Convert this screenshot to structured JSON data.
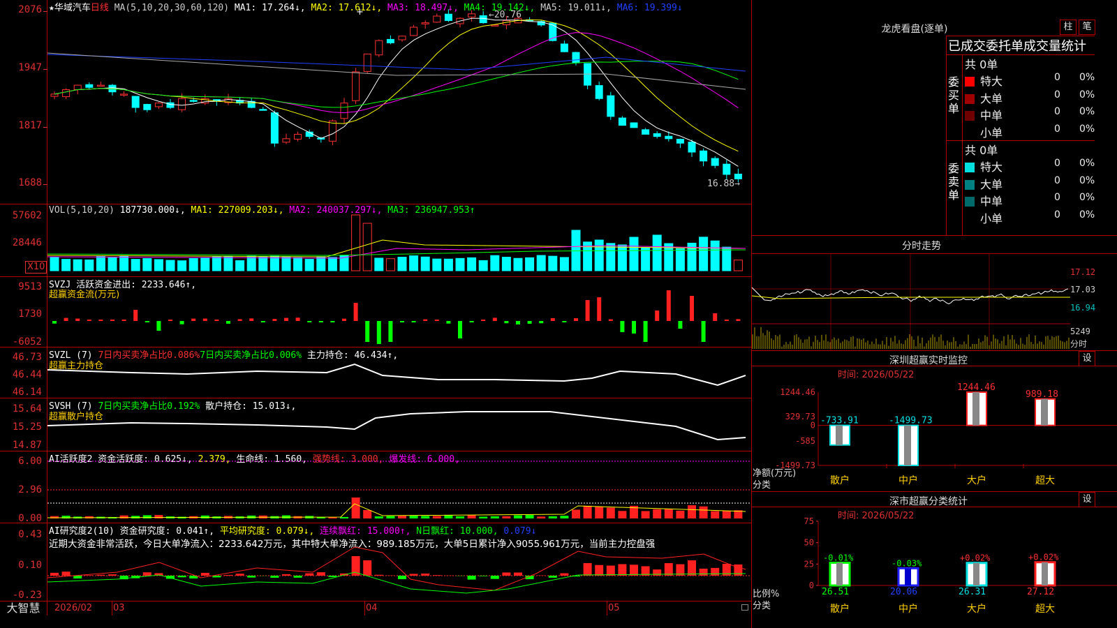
{
  "header": {
    "star": "★",
    "stock_name": "华域汽车",
    "period": "日线",
    "ma_param": "MA(5,10,20,30,60,120)",
    "ma1": "MA1: 17.264↓,",
    "ma2": "MA2: 17.612↓,",
    "ma3": "MA3: 18.497↓,",
    "ma4": "MA4: 19.142↓,",
    "ma5": "MA5: 19.011↓,",
    "ma6": "MA6: 19.399↓",
    "plus": "+"
  },
  "kline": {
    "y_labels": [
      "2076",
      "1947",
      "1817",
      "1688"
    ],
    "high_label": "20.76",
    "low_label": "16.88"
  },
  "vol": {
    "legend_param": "VOL(5,10,20)",
    "legend_value": "187730.000↓,",
    "ma1": "MA1: 227009.203↓,",
    "ma2": "MA2: 240037.297↓,",
    "ma3": "MA3: 236947.953↑",
    "y_labels": [
      "57602",
      "28446"
    ],
    "unit": "X10"
  },
  "svzj": {
    "legend": "SVZJ  活跃资金进出: 2233.646↑,",
    "sub": "超赢资金流(万元)",
    "y_labels": [
      "9513",
      "1730",
      "-6052"
    ]
  },
  "svzl": {
    "legend_a": "SVZL (7)",
    "legend_b": "7日内买卖净占比0.086%",
    "legend_c": "7日内买卖净占比0.006%",
    "legend_d": "主力持仓: 46.434↑,",
    "sub": "超赢主力持仓",
    "y_labels": [
      "46.73",
      "46.44",
      "46.14"
    ]
  },
  "svsh": {
    "legend_a": "SVSH (7)",
    "legend_b": "7日内买卖净占比0.192%",
    "legend_c": "散户持仓: 15.013↓,",
    "sub": "超赢散户持仓",
    "y_labels": [
      "15.64",
      "15.25",
      "14.87"
    ]
  },
  "ai_active": {
    "legend_a": "AI活跃度2 资金活跃度: 0.625↓,",
    "legend_b": "2.379,",
    "legend_c": "生命线: 1.560,",
    "legend_d": "强势线: 3.000,",
    "legend_e": "爆发线: 6.000,",
    "y_labels": [
      "6.00",
      "2.96",
      "0.00"
    ]
  },
  "ai_research": {
    "legend_a": "AI研究度2(10) 资金研究度: 0.041↑,",
    "legend_b": "平均研究度: 0.079↓,",
    "legend_c": "连续飘红: 15.000↑,",
    "legend_d": "N日飘红: 10.000,",
    "legend_e": "0.079↓",
    "comment": "近期大资金非常活跃，今日大单净流入：2233.642万元，其中特大单净流入：989.185万元，大单5日累计净入9055.961万元，当前主力控盘强",
    "y_labels": [
      "0.43",
      "0.10",
      "-0.23"
    ]
  },
  "bottom": {
    "brand": "大智慧",
    "dates": [
      "2026/02",
      "03",
      "04",
      "05"
    ]
  },
  "right": {
    "lhb_title": "龙虎看盘(逐单)",
    "btn_zhu": "柱",
    "btn_bi": "笔",
    "stat_title": "已成交委托单成交量统计",
    "buy": {
      "side_label": "委买单",
      "total": "共 0单",
      "rows": [
        {
          "label": "特大",
          "count": "0",
          "pct": "0%",
          "color": "#ff0000"
        },
        {
          "label": "大单",
          "count": "0",
          "pct": "0%",
          "color": "#a00000"
        },
        {
          "label": "中单",
          "count": "0",
          "pct": "0%",
          "color": "#700000"
        },
        {
          "label": "小单",
          "count": "0",
          "pct": "0%",
          "color": ""
        }
      ]
    },
    "sell": {
      "side_label": "委卖单",
      "total": "共 0单",
      "rows": [
        {
          "label": "特大",
          "count": "0",
          "pct": "0%",
          "color": "#00e0e0"
        },
        {
          "label": "大单",
          "count": "0",
          "pct": "0%",
          "color": "#008080"
        },
        {
          "label": "中单",
          "count": "0",
          "pct": "0%",
          "color": "#006a6a"
        },
        {
          "label": "小单",
          "count": "0",
          "pct": "0%",
          "color": ""
        }
      ]
    },
    "intraday": {
      "title": "分时走势",
      "y_labels": [
        "17.12",
        "17.03",
        "16.94"
      ],
      "vol_label": "5249",
      "vol_unit": "分时"
    },
    "sz_monitor": {
      "title": "深圳超赢实时监控",
      "btn": "设",
      "time": "时间: 2026/05/22",
      "y_labels": [
        "1244.46",
        "329.73",
        "0",
        "-585",
        "-1499.73"
      ],
      "axis_title_a": "净额(万元)",
      "axis_title_b": "分类",
      "categories": [
        "散户",
        "中户",
        "大户",
        "超大"
      ],
      "values": [
        -733.91,
        -1499.73,
        1244.46,
        989.18
      ],
      "value_labels": [
        "-733.91",
        "-1499.73",
        "1244.46",
        "989.18"
      ]
    },
    "sz_class": {
      "title": "深市超赢分类统计",
      "btn": "设",
      "time": "时间: 2026/05/22",
      "y_labels": [
        "75",
        "50",
        "25",
        "0"
      ],
      "axis_title_a": "比例%",
      "axis_title_b": "分类",
      "categories": [
        "散户",
        "中户",
        "大户",
        "超大"
      ],
      "ratios": [
        26.51,
        20.06,
        26.31,
        27.12
      ],
      "ratio_labels": [
        "26.51",
        "20.06",
        "26.31",
        "27.12"
      ],
      "change_labels": [
        "-0.01%",
        "-0.03%",
        "+0.02%",
        "+0.02%"
      ]
    }
  }
}
